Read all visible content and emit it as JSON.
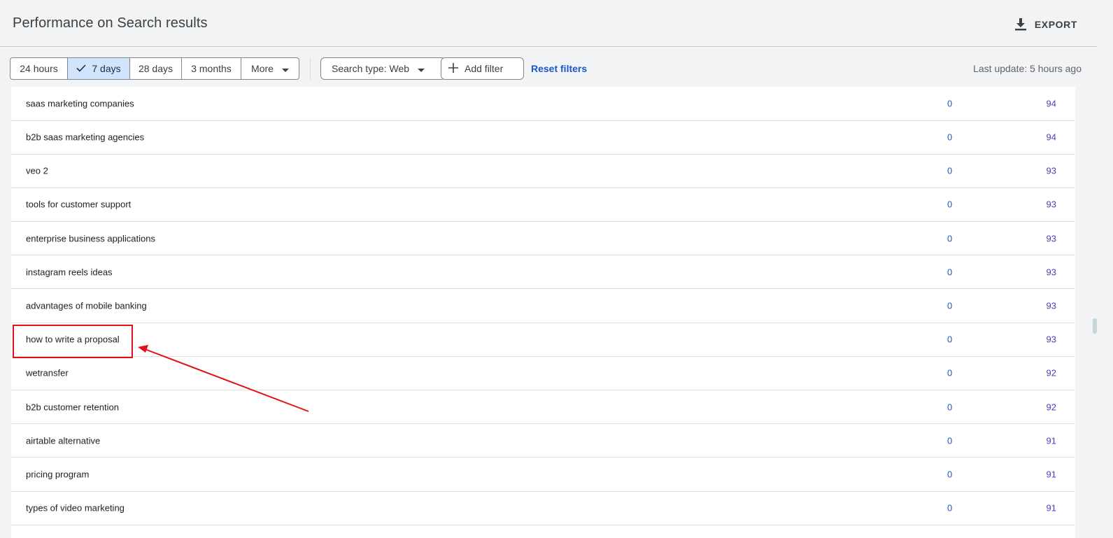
{
  "header": {
    "title": "Performance on Search results",
    "export_label": "EXPORT",
    "export_icon": "download-icon"
  },
  "filters": {
    "date_ranges": [
      {
        "label": "24 hours",
        "selected": false
      },
      {
        "label": "7 days",
        "selected": true
      },
      {
        "label": "28 days",
        "selected": false
      },
      {
        "label": "3 months",
        "selected": false
      },
      {
        "label": "More",
        "selected": false
      }
    ],
    "search_type_label": "Search type: Web",
    "add_filter_label": "Add filter",
    "reset_label": "Reset filters",
    "last_update": "Last update: 5 hours ago"
  },
  "rows": [
    {
      "query": "saas marketing companies",
      "clicks": "0",
      "impressions": "94"
    },
    {
      "query": "b2b saas marketing agencies",
      "clicks": "0",
      "impressions": "94"
    },
    {
      "query": "veo 2",
      "clicks": "0",
      "impressions": "93"
    },
    {
      "query": "tools for customer support",
      "clicks": "0",
      "impressions": "93"
    },
    {
      "query": "enterprise business applications",
      "clicks": "0",
      "impressions": "93"
    },
    {
      "query": "instagram reels ideas",
      "clicks": "0",
      "impressions": "93"
    },
    {
      "query": "advantages of mobile banking",
      "clicks": "0",
      "impressions": "93"
    },
    {
      "query": "how to write a proposal",
      "clicks": "0",
      "impressions": "93"
    },
    {
      "query": "wetransfer",
      "clicks": "0",
      "impressions": "92"
    },
    {
      "query": "b2b customer retention",
      "clicks": "0",
      "impressions": "92"
    },
    {
      "query": "airtable alternative",
      "clicks": "0",
      "impressions": "91"
    },
    {
      "query": "pricing program",
      "clicks": "0",
      "impressions": "91"
    },
    {
      "query": "types of video marketing",
      "clicks": "0",
      "impressions": "91"
    }
  ],
  "colors": {
    "background": "#f1f3f4",
    "selected_segment": "#d2e3fc",
    "link_blue": "#1a57c9",
    "impressions_purple": "#5e35b1",
    "annotation_red": "#e3121a"
  }
}
